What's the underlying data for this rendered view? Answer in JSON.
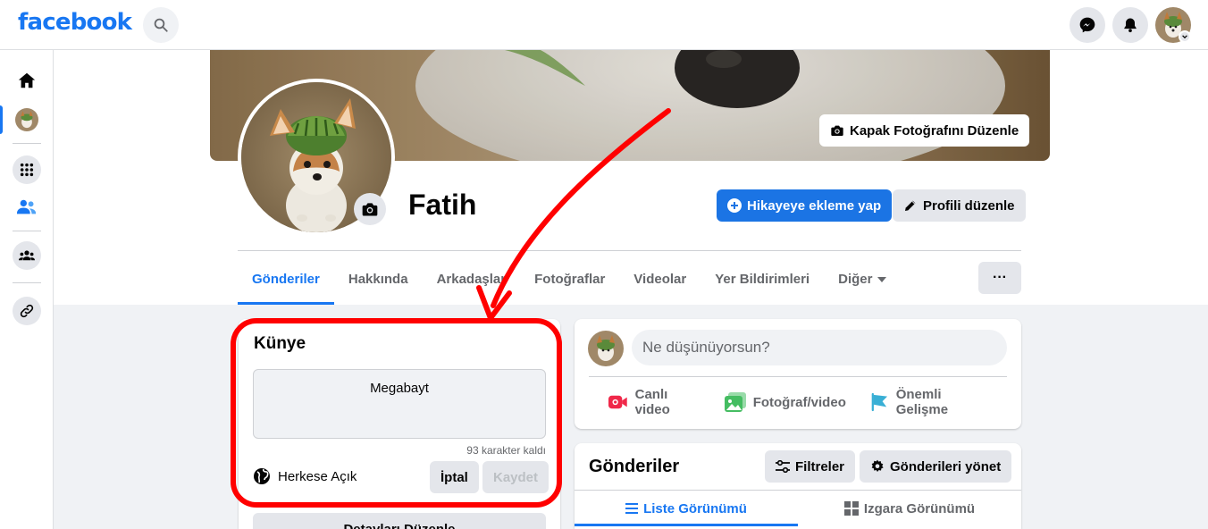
{
  "brand": {
    "logo_text": "facebook",
    "accent": "#1877f2"
  },
  "topbar": {
    "icons": [
      "search-icon",
      "messenger-icon",
      "bell-icon",
      "avatar"
    ]
  },
  "leftrail": {
    "icons": [
      "home-icon",
      "profile-avatar",
      "apps-grid-icon",
      "friends-icon",
      "groups-icon",
      "link-icon"
    ]
  },
  "profile": {
    "name": "Fatih",
    "edit_cover_label": "Kapak Fotoğrafını Düzenle",
    "add_story_label": "Hikayeye ekleme yap",
    "edit_profile_label": "Profili düzenle",
    "tabs": [
      {
        "label": "Gönderiler",
        "active": true
      },
      {
        "label": "Hakkında"
      },
      {
        "label": "Arkadaşlar"
      },
      {
        "label": "Fotoğraflar"
      },
      {
        "label": "Videolar"
      },
      {
        "label": "Yer Bildirimleri"
      },
      {
        "label": "Diğer"
      }
    ],
    "more_label": "···"
  },
  "intro": {
    "title": "Künye",
    "bio_value": "Megabayt",
    "chars_left": "93 karakter kaldı",
    "audience": "Herkese Açık",
    "cancel_label": "İptal",
    "save_label": "Kaydet",
    "details_label": "Detayları Düzenle"
  },
  "composer": {
    "placeholder": "Ne düşünüyorsun?",
    "actions": [
      {
        "label": "Canlı video",
        "icon": "live-video-icon",
        "color": "#f02849"
      },
      {
        "label": "Fotoğraf/video",
        "icon": "photo-icon",
        "color": "#45bd62"
      },
      {
        "label": "Önemli Gelişme",
        "icon": "flag-icon",
        "color": "#39afd5"
      }
    ]
  },
  "posts": {
    "title": "Gönderiler",
    "filters_label": "Filtreler",
    "manage_label": "Gönderileri yönet",
    "list_view_label": "Liste Görünümü",
    "grid_view_label": "Izgara Görünümü"
  },
  "annotation": {
    "color": "#ff0000"
  }
}
